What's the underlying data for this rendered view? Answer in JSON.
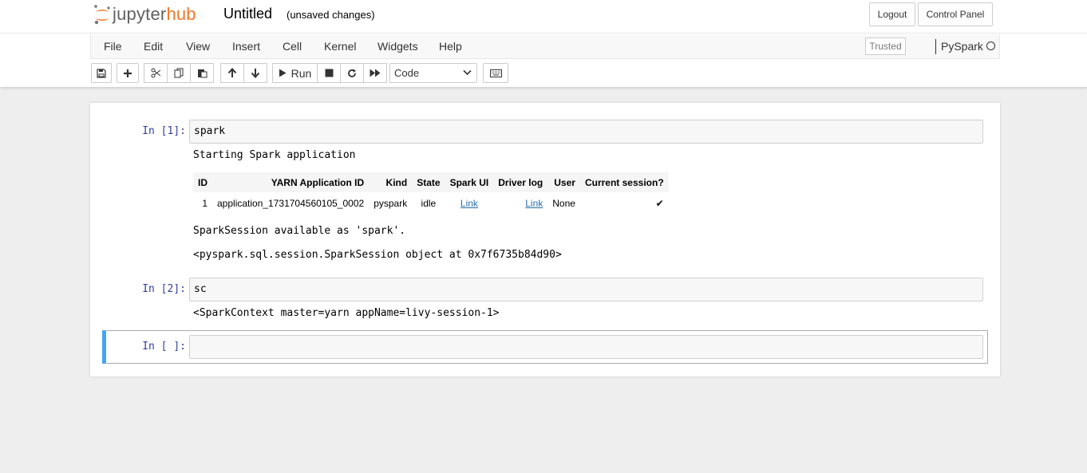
{
  "header": {
    "logo_jupyter": "jupyter",
    "logo_hub": "hub",
    "notebook_title": "Untitled",
    "save_status": "(unsaved changes)",
    "logout_label": "Logout",
    "control_panel_label": "Control Panel"
  },
  "menu": {
    "items": [
      "File",
      "Edit",
      "View",
      "Insert",
      "Cell",
      "Kernel",
      "Widgets",
      "Help"
    ],
    "trusted_label": "Trusted",
    "kernel_name": "PySpark"
  },
  "toolbar": {
    "run_label": "Run",
    "cell_type": "Code",
    "icons": [
      "save-icon",
      "plus-icon",
      "cut-icon",
      "copy-icon",
      "paste-icon",
      "arrow-up-icon",
      "arrow-down-icon",
      "play-icon",
      "stop-icon",
      "restart-icon",
      "fast-forward-icon",
      "keyboard-icon"
    ]
  },
  "cells": [
    {
      "prompt": "In [1]:",
      "source": "spark",
      "output_start": "Starting Spark application",
      "table": {
        "headers": [
          "ID",
          "YARN Application ID",
          "Kind",
          "State",
          "Spark UI",
          "Driver log",
          "User",
          "Current session?"
        ],
        "row": {
          "id": "1",
          "app_id": "application_1731704560105_0002",
          "kind": "pyspark",
          "state": "idle",
          "spark_ui": "Link",
          "driver_log": "Link",
          "user": "None",
          "current": "✔"
        }
      },
      "output_session": "SparkSession available as 'spark'.",
      "output_repr": "<pyspark.sql.session.SparkSession object at 0x7f6735b84d90>"
    },
    {
      "prompt": "In [2]:",
      "source": "sc",
      "output_repr": "<SparkContext master=yarn appName=livy-session-1>"
    },
    {
      "prompt": "In [ ]:",
      "source": ""
    }
  ],
  "colors": {
    "prompt_blue": "#303f9f",
    "selected_cell_border": "#42a5f5",
    "logo_orange": "#f37726",
    "link_blue": "#296eaa"
  }
}
